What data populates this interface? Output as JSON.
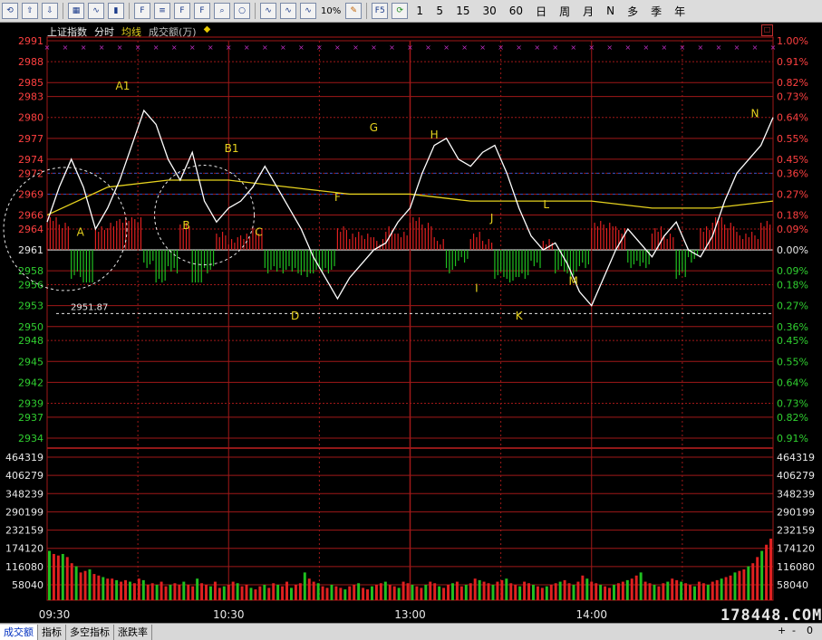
{
  "toolbar": {
    "icons": [
      "back-icon",
      "arrow-up-icon",
      "arrow-down-icon",
      "table-icon",
      "line-chart-icon",
      "candlestick-icon",
      "f10-icon",
      "text-icon",
      "f10-alt-icon",
      "fiz-icon",
      "zoom-icon",
      "circle-icon",
      "indicator-icon",
      "indicator2-icon",
      "indicator3-icon"
    ],
    "pct_label": "10%",
    "pen": "pencil-icon",
    "f5_label": "F5",
    "periods": [
      "1",
      "5",
      "15",
      "30",
      "60",
      "日",
      "周",
      "月",
      "N",
      "多",
      "季",
      "年"
    ]
  },
  "info": {
    "title": "上证指数",
    "mode": "分时",
    "ma": "均线",
    "vol": "成交额(万)",
    "arrow": "◆"
  },
  "chart_data": {
    "type": "line",
    "prev_close": 2961,
    "price_ticks": [
      "2991",
      "2988",
      "2985",
      "2983",
      "2980",
      "2977",
      "2974",
      "2972",
      "2969",
      "2966",
      "2964",
      "2961",
      "2958",
      "2956",
      "2953",
      "2950",
      "2948",
      "2945",
      "2942",
      "2939",
      "2937",
      "2934"
    ],
    "pct_ticks": [
      "1.00%",
      "0.91%",
      "0.82%",
      "0.73%",
      "0.64%",
      "0.55%",
      "0.45%",
      "0.36%",
      "0.27%",
      "0.18%",
      "0.09%",
      "0.00%",
      "0.09%",
      "0.18%",
      "0.27%",
      "0.36%",
      "0.45%",
      "0.55%",
      "0.64%",
      "0.73%",
      "0.82%",
      "0.91%"
    ],
    "vol_ticks": [
      "464319",
      "406279",
      "348239",
      "290199",
      "232159",
      "174120",
      "116080",
      "58040"
    ],
    "time_labels": [
      "09:30",
      "10:30",
      "13:00",
      "14:00"
    ],
    "ylim": [
      2934,
      2991
    ],
    "price_series": {
      "name": "",
      "x": [
        0,
        4,
        8,
        12,
        16,
        20,
        24,
        28,
        32,
        36,
        40,
        44,
        48,
        52,
        56,
        60,
        64,
        68,
        72,
        76,
        80,
        84,
        88,
        92,
        96,
        100,
        104,
        108,
        112,
        116,
        120,
        124,
        128,
        132,
        136,
        140,
        144,
        148,
        152,
        156,
        160,
        164,
        168,
        172,
        176,
        180,
        184,
        188,
        192,
        196,
        200,
        204,
        208,
        212,
        216,
        220,
        224,
        228,
        232,
        236,
        240
      ],
      "values": [
        2965,
        2970,
        2974,
        2970,
        2964,
        2967,
        2971,
        2976,
        2981,
        2979,
        2974,
        2971,
        2975,
        2968,
        2965,
        2967,
        2968,
        2970,
        2973,
        2970,
        2967,
        2964,
        2960,
        2957,
        2954,
        2957,
        2959,
        2961,
        2962,
        2965,
        2967,
        2972,
        2976,
        2977,
        2974,
        2973,
        2975,
        2976,
        2972,
        2967,
        2963,
        2961,
        2962,
        2959,
        2955,
        2953,
        2957,
        2961,
        2964,
        2962,
        2960,
        2963,
        2965,
        2961,
        2960,
        2963,
        2968,
        2972,
        2974,
        2976,
        2980
      ]
    },
    "avg_series": {
      "name": "",
      "x": [
        0,
        20,
        40,
        60,
        80,
        100,
        120,
        140,
        160,
        180,
        200,
        220,
        240
      ],
      "values": [
        2966,
        2970,
        2971,
        2971,
        2970,
        2969,
        2969,
        2968,
        2968,
        2968,
        2967,
        2967,
        2968
      ]
    },
    "low_marker": {
      "label": "2951.87",
      "value": 2951.87
    },
    "annotations": [
      {
        "label": "A",
        "x": 11,
        "y": 2963
      },
      {
        "label": "A1",
        "x": 25,
        "y": 2984
      },
      {
        "label": "B",
        "x": 46,
        "y": 2964
      },
      {
        "label": "B1",
        "x": 61,
        "y": 2975
      },
      {
        "label": "C",
        "x": 70,
        "y": 2963
      },
      {
        "label": "D",
        "x": 82,
        "y": 2951
      },
      {
        "label": "F",
        "x": 96,
        "y": 2968
      },
      {
        "label": "G",
        "x": 108,
        "y": 2978
      },
      {
        "label": "H",
        "x": 128,
        "y": 2977
      },
      {
        "label": "I",
        "x": 142,
        "y": 2955
      },
      {
        "label": "J",
        "x": 147,
        "y": 2965
      },
      {
        "label": "K",
        "x": 156,
        "y": 2951
      },
      {
        "label": "L",
        "x": 165,
        "y": 2967
      },
      {
        "label": "M",
        "x": 174,
        "y": 2956
      },
      {
        "label": "N",
        "x": 234,
        "y": 2980
      }
    ],
    "volume_series": {
      "name": "",
      "values": [
        160000,
        150000,
        145000,
        150000,
        140000,
        120000,
        110000,
        90000,
        95000,
        100000,
        85000,
        80000,
        75000,
        70000,
        70000,
        65000,
        60000,
        65000,
        60000,
        55000,
        70000,
        65000,
        50000,
        55000,
        50000,
        60000,
        45000,
        50000,
        55000,
        50000,
        60000,
        50000,
        45000,
        70000,
        55000,
        50000,
        45000,
        60000,
        40000,
        45000,
        50000,
        60000,
        55000,
        45000,
        50000,
        40000,
        35000,
        45000,
        50000,
        40000,
        55000,
        50000,
        45000,
        60000,
        40000,
        50000,
        55000,
        90000,
        70000,
        60000,
        55000,
        45000,
        40000,
        50000,
        45000,
        40000,
        35000,
        45000,
        50000,
        55000,
        40000,
        35000,
        45000,
        50000,
        55000,
        60000,
        50000,
        45000,
        40000,
        60000,
        55000,
        50000,
        45000,
        40000,
        50000,
        60000,
        55000,
        45000,
        40000,
        50000,
        55000,
        60000,
        45000,
        50000,
        55000,
        70000,
        65000,
        60000,
        55000,
        50000,
        60000,
        65000,
        70000,
        55000,
        50000,
        45000,
        60000,
        55000,
        50000,
        45000,
        40000,
        45000,
        50000,
        55000,
        60000,
        65000,
        55000,
        50000,
        60000,
        80000,
        70000,
        60000,
        55000,
        50000,
        45000,
        40000,
        50000,
        55000,
        60000,
        65000,
        70000,
        80000,
        90000,
        60000,
        55000,
        50000,
        45000,
        55000,
        60000,
        70000,
        65000,
        60000,
        55000,
        50000,
        45000,
        60000,
        55000,
        50000,
        60000,
        65000,
        70000,
        75000,
        80000,
        90000,
        95000,
        100000,
        110000,
        120000,
        140000,
        160000,
        180000,
        200000
      ]
    }
  },
  "watermark": "178448.COM",
  "bottom_tabs": [
    "成交额",
    "指标",
    "多空指标",
    "涨跌率"
  ],
  "bottom_ctrls": [
    "+",
    "-",
    "0"
  ]
}
